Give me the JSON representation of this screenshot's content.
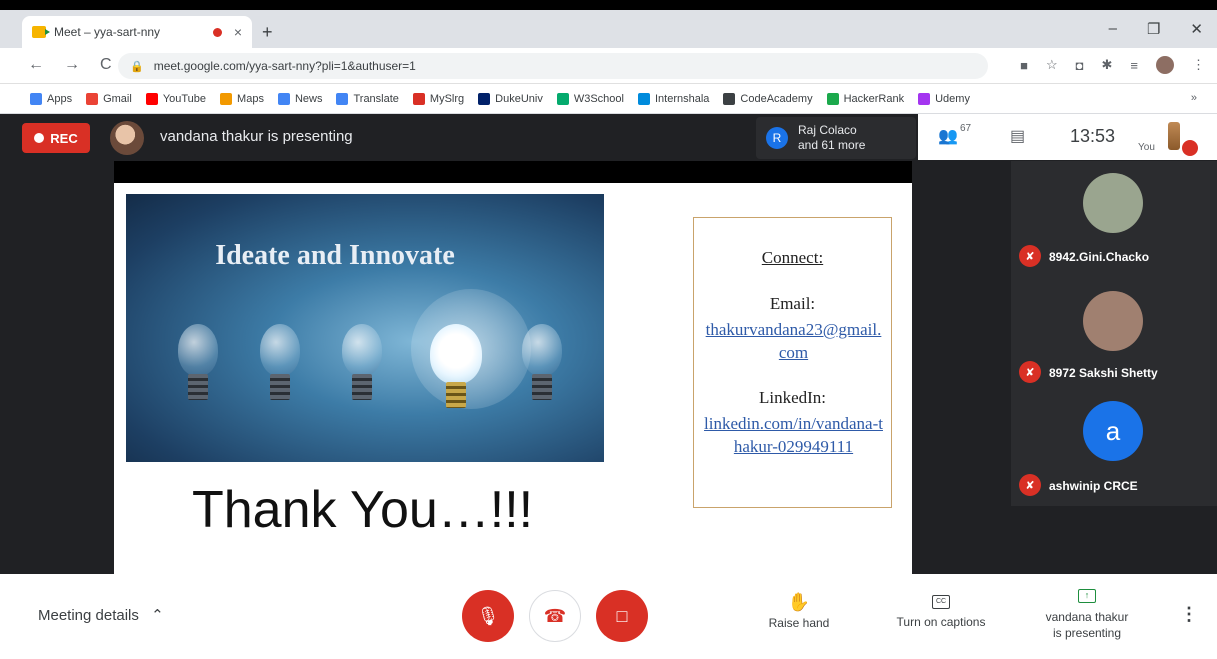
{
  "browser": {
    "tab_title": "Meet – yya-sart-nny",
    "tab_close": "×",
    "new_tab": "+",
    "window_controls": [
      "–",
      "❐",
      "✕"
    ],
    "nav": [
      "←",
      "→",
      "C"
    ],
    "url": "meet.google.com/yya-sart-nny?pli=1&authuser=1",
    "extensions": [
      "■",
      "☆",
      "◘",
      "✱",
      "≡",
      "⋮"
    ],
    "bookmarks": [
      {
        "label": "Apps",
        "color": "#4285f4"
      },
      {
        "label": "Gmail",
        "color": "#ea4335"
      },
      {
        "label": "YouTube",
        "color": "#ff0000"
      },
      {
        "label": "Maps",
        "color": "#f29900"
      },
      {
        "label": "News",
        "color": "#4285f4"
      },
      {
        "label": "Translate",
        "color": "#4285f4"
      },
      {
        "label": "MySlrg",
        "color": "#d93025"
      },
      {
        "label": "DukeUniv",
        "color": "#012169"
      },
      {
        "label": "W3School",
        "color": "#04aa6d"
      },
      {
        "label": "Internshala",
        "color": "#008bdc"
      },
      {
        "label": "CodeAcademy",
        "color": "#3c4043"
      },
      {
        "label": "HackerRank",
        "color": "#1ba94c"
      },
      {
        "label": "Udemy",
        "color": "#a435f0"
      }
    ],
    "bookmarks_more": "»"
  },
  "meet": {
    "rec_label": "REC",
    "presenting_text": "vandana thakur is presenting",
    "speaker_initial": "R",
    "speaker_name": "Raj Colaco",
    "speaker_more": "and 61 more",
    "people_count": "67",
    "time": "13:53",
    "self_label": "You"
  },
  "slide": {
    "heading": "Ideate and Innovate",
    "connect": "Connect:",
    "email_label": "Email:",
    "email": "thakurvandana23@gmail.com",
    "linkedin_label": "LinkedIn:",
    "linkedin": "linkedin.com/in/vandana-thakur-029949111",
    "thank_you": "Thank You…!!!"
  },
  "participants": [
    {
      "name": "8942.Gini.Chacko",
      "avatar_color": "#9aa58f"
    },
    {
      "name": "8972 Sakshi Shetty",
      "avatar_color": "#a08070"
    },
    {
      "name": "ashwinip CRCE",
      "initial": "a",
      "avatar_color": "#1a73e8"
    }
  ],
  "controls": {
    "meeting_details": "Meeting details",
    "raise_hand": "Raise hand",
    "captions": "Turn on captions",
    "captions_icon": "CC",
    "presenting_line1": "vandana thakur",
    "presenting_line2": "is presenting",
    "more": "⋮"
  }
}
